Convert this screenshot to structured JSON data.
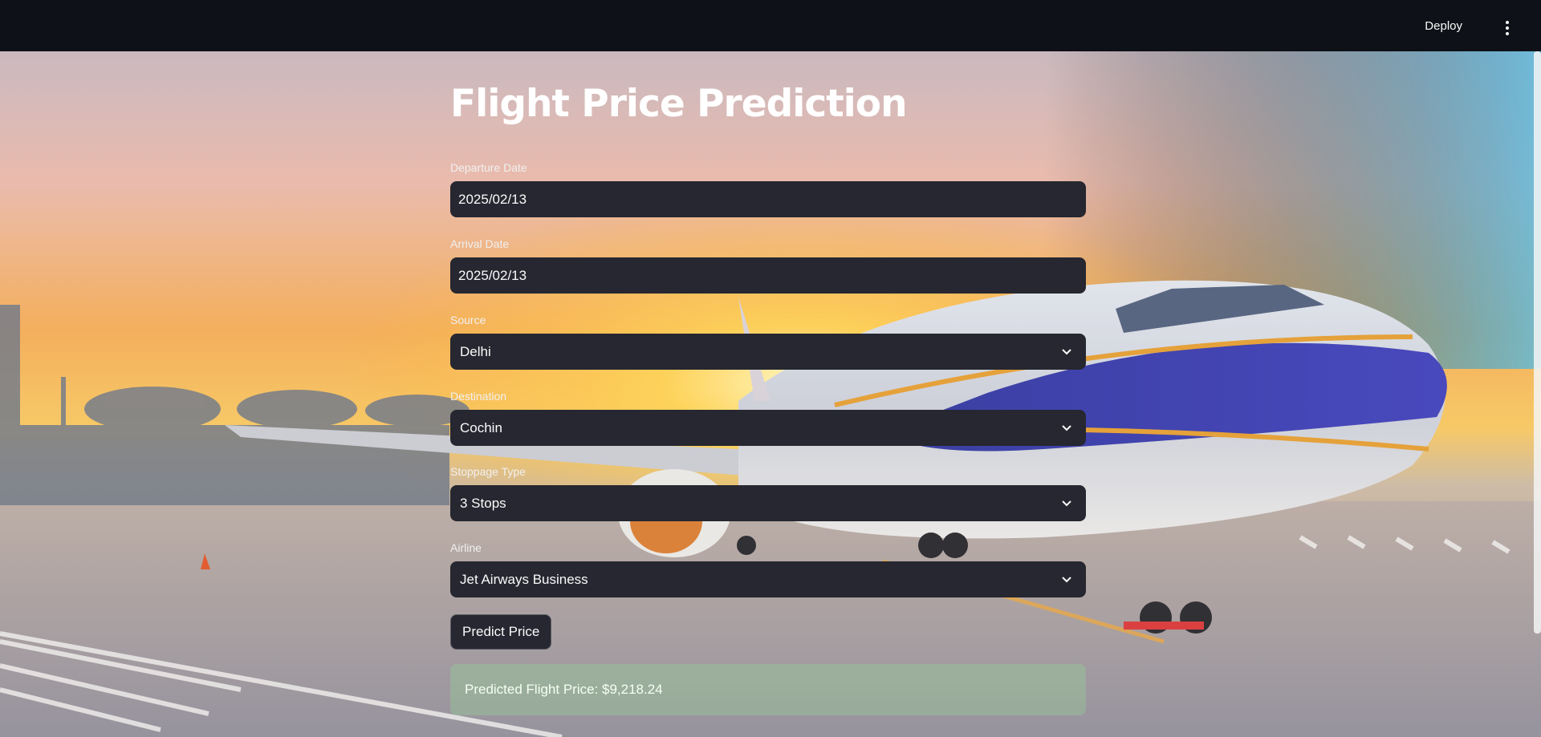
{
  "header": {
    "deploy_label": "Deploy",
    "menu_icon": "kebab-menu-icon"
  },
  "page": {
    "title": "Flight Price Prediction"
  },
  "form": {
    "departure_date": {
      "label": "Departure Date",
      "value": "2025/02/13"
    },
    "arrival_date": {
      "label": "Arrival Date",
      "value": "2025/02/13"
    },
    "source": {
      "label": "Source",
      "value": "Delhi"
    },
    "destination": {
      "label": "Destination",
      "value": "Cochin"
    },
    "stoppage_type": {
      "label": "Stoppage Type",
      "value": "3 Stops"
    },
    "airline": {
      "label": "Airline",
      "value": "Jet Airways Business"
    },
    "predict_label": "Predict Price"
  },
  "result": {
    "text": "Predicted Flight Price: $9,218.24"
  },
  "colors": {
    "topbar": "#0e1117",
    "input_bg": "#262730",
    "success_bg": "#7fb57f"
  }
}
